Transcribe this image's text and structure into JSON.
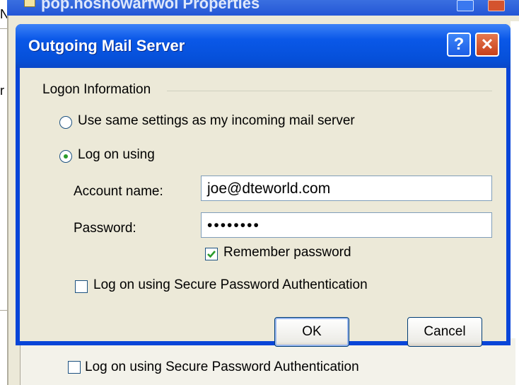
{
  "background": {
    "window_title": "pop.hoshowarfwol Properties",
    "left_chars": [
      "N",
      "r"
    ],
    "checkbox_label": "Log on using Secure Password Authentication"
  },
  "dialog": {
    "title": "Outgoing Mail Server",
    "help_glyph": "?",
    "close_glyph": "✕",
    "group_label": "Logon Information",
    "radio_same": "Use same settings as my incoming mail server",
    "radio_logon": "Log on using",
    "selected_radio": "Log on using",
    "account_label": "Account name:",
    "account_value": "joe@dteworld.com",
    "password_label": "Password:",
    "password_value": "••••••••",
    "remember_label": "Remember password",
    "remember_checked": true,
    "spa_label": "Log on using Secure Password Authentication",
    "spa_checked": false,
    "ok_label": "OK",
    "cancel_label": "Cancel"
  },
  "colors": {
    "titlebar": "#0650d9",
    "client_bg": "#ece9d8",
    "close_button": "#c8401a",
    "check_accent": "#2a9b2a"
  }
}
